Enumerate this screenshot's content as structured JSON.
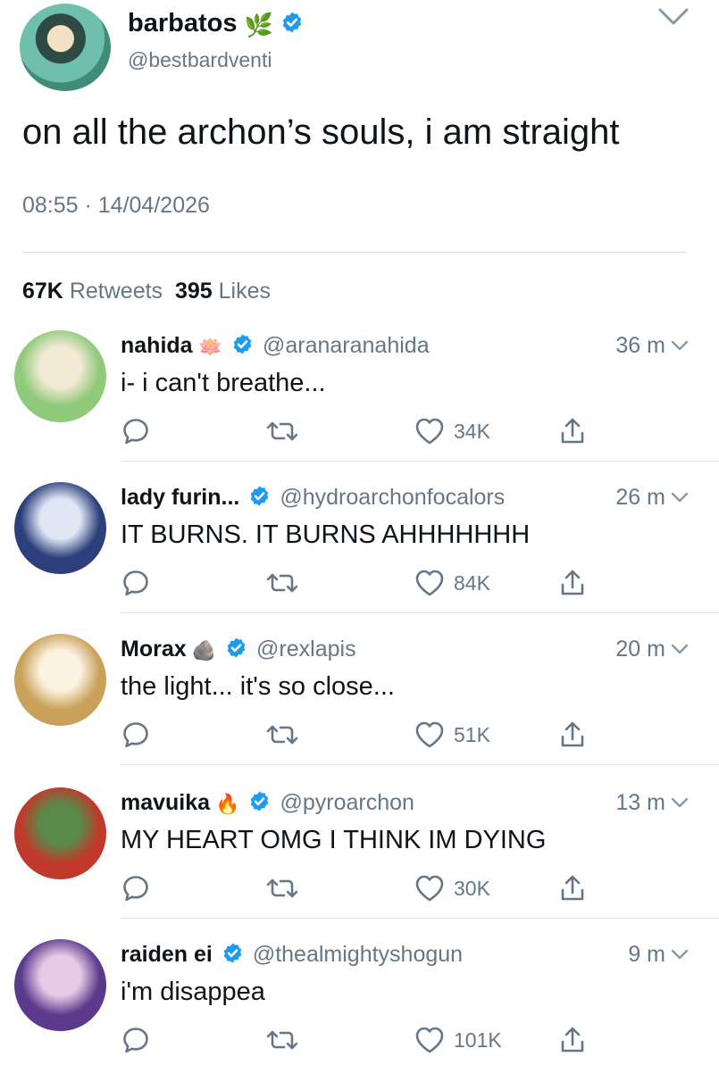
{
  "main_tweet": {
    "name": "barbatos",
    "name_emoji": "🌿",
    "handle": "@bestbardventi",
    "text": "on all the archon’s souls, i am straight",
    "timestamp": "08:55 · 14/04/2026",
    "retweets_count": "67K",
    "retweets_label": "Retweets",
    "likes_count": "395",
    "likes_label": "Likes",
    "verified": true,
    "avatar_colors": [
      "#6ec0ad",
      "#2f4a43"
    ]
  },
  "icons": {
    "verified": "verified-badge-icon",
    "chevron": "chevron-down-icon",
    "reply": "reply-icon",
    "retweet": "retweet-icon",
    "like": "heart-icon",
    "share": "share-icon"
  },
  "colors": {
    "verified_blue": "#1d9bf0",
    "secondary_text": "#657786",
    "icon_gray": "#657786"
  },
  "replies": [
    {
      "name": "nahida",
      "name_emoji": "🪷",
      "handle": "@aranaranahida",
      "time": "36 m",
      "text": "i- i can't breathe...",
      "likes": "34K",
      "avatar_colors": [
        "#8fc97a",
        "#f3ead6"
      ]
    },
    {
      "name": "lady furin...",
      "name_emoji": "",
      "handle": "@hydroarchonfocalors",
      "time": "26 m",
      "text": "IT BURNS. IT BURNS AHHHHHHH",
      "likes": "84K",
      "avatar_colors": [
        "#2c3f7a",
        "#dfe7f5"
      ]
    },
    {
      "name": "Morax",
      "name_emoji": "🪨",
      "handle": "@rexlapis",
      "time": "20 m",
      "text": "the light... it's so close...",
      "likes": "51K",
      "avatar_colors": [
        "#c9a15a",
        "#fbf3e2"
      ]
    },
    {
      "name": "mavuika",
      "name_emoji": "🔥",
      "handle": "@pyroarchon",
      "time": "13 m",
      "text": "MY HEART OMG I THINK IM DYING",
      "likes": "30K",
      "avatar_colors": [
        "#c0392b",
        "#5a8a4a"
      ]
    },
    {
      "name": "raiden ei",
      "name_emoji": "",
      "handle": "@thealmightyshogun",
      "time": "9 m",
      "text": "i'm disappea",
      "likes": "101K",
      "avatar_colors": [
        "#5b3a8c",
        "#e8c9e6"
      ]
    }
  ]
}
